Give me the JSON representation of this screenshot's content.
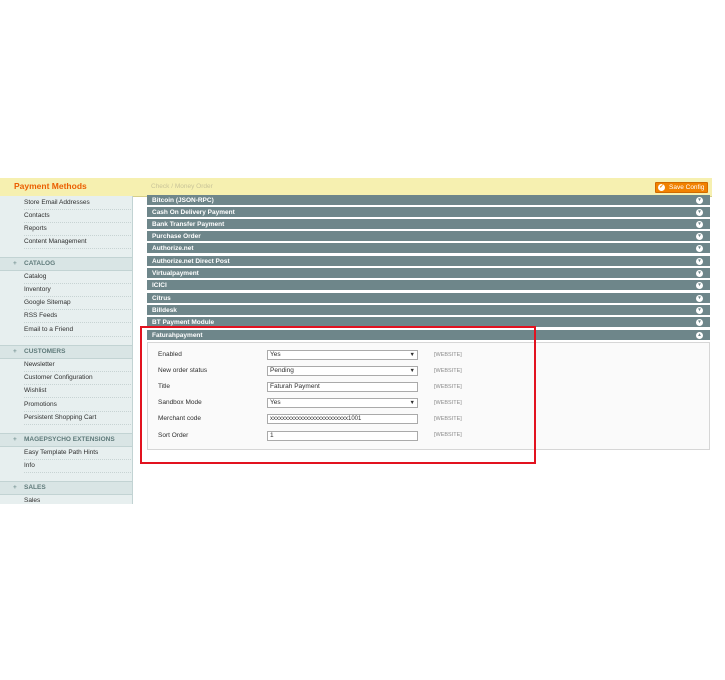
{
  "header": {
    "title": "Payment Methods",
    "ghost_title": "Check / Money Order",
    "save_label": "Save Config"
  },
  "sidebar": {
    "group_top": [
      "Store Email Addresses",
      "Contacts",
      "Reports",
      "Content Management"
    ],
    "catalog": {
      "title": "CATALOG",
      "items": [
        "Catalog",
        "Inventory",
        "Google Sitemap",
        "RSS Feeds",
        "Email to a Friend"
      ]
    },
    "customers": {
      "title": "CUSTOMERS",
      "items": [
        "Newsletter",
        "Customer Configuration",
        "Wishlist",
        "Promotions",
        "Persistent Shopping Cart"
      ]
    },
    "magepsycho": {
      "title": "MAGEPSYCHO EXTENSIONS",
      "items": [
        "Easy Template Path Hints",
        "Info"
      ]
    },
    "sales": {
      "title": "SALES",
      "items": [
        "Sales"
      ]
    }
  },
  "payment_rows": [
    "Bitcoin (JSON-RPC)",
    "Cash On Delivery Payment",
    "Bank Transfer Payment",
    "Purchase Order",
    "Authorize.net",
    "Authorize.net Direct Post",
    "Virtualpayment",
    "ICICI",
    "Citrus",
    "Billdesk",
    "BT Payment Module",
    "Faturahpayment"
  ],
  "form": {
    "enabled": {
      "label": "Enabled",
      "value": "Yes",
      "scope": "[WEBSITE]"
    },
    "new_order_status": {
      "label": "New order status",
      "value": "Pending",
      "scope": "[WEBSITE]"
    },
    "title": {
      "label": "Title",
      "value": "Faturah Payment",
      "scope": "[WEBSITE]"
    },
    "sandbox_mode": {
      "label": "Sandbox Mode",
      "value": "Yes",
      "scope": "[WEBSITE]"
    },
    "merchant_code": {
      "label": "Merchant code",
      "value": "xxxxxxxxxxxxxxxxxxxxxxxxxx1001",
      "scope": "[WEBSITE]"
    },
    "sort_order": {
      "label": "Sort Order",
      "value": "1",
      "scope": "[WEBSITE]"
    }
  },
  "colors": {
    "accent": "#eb5e00",
    "button": "#f18200",
    "row": "#6e868a",
    "highlight": "#e2121f"
  }
}
